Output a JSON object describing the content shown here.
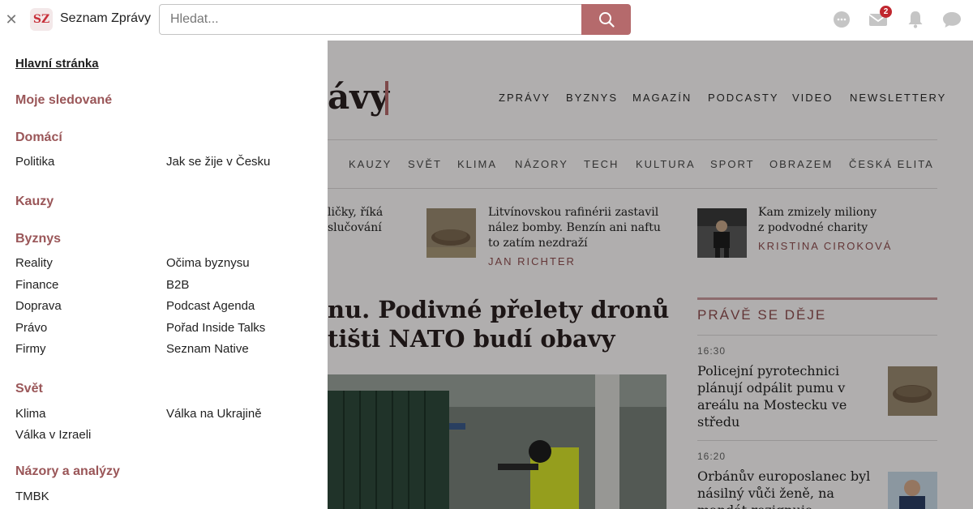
{
  "topbar": {
    "brand_logo": "SZ",
    "brand_name": "Seznam Zprávy",
    "search_placeholder": "Hledat...",
    "mail_badge": "2",
    "icons": [
      "close-icon",
      "search-icon",
      "chat-bubble-icon",
      "mail-icon",
      "bell-icon",
      "message-icon"
    ]
  },
  "drawer": {
    "home": "Hlavní stránka",
    "followed": "Moje sledované",
    "domestic": {
      "heading": "Domácí",
      "items": [
        "Politika",
        "Jak se žije v Česku"
      ]
    },
    "affairs": {
      "heading": "Kauzy"
    },
    "business": {
      "heading": "Byznys",
      "items": [
        "Reality",
        "Očima byznysu",
        "Finance",
        "B2B",
        "Doprava",
        "Podcast Agenda",
        "Právo",
        "Pořad Inside Talks",
        "Firmy",
        "Seznam Native"
      ]
    },
    "world": {
      "heading": "Svět",
      "items": [
        "Klima",
        "Válka na Ukrajině",
        "Válka v Izraeli"
      ]
    },
    "opinions": {
      "heading": "Názory a analýzy",
      "items": [
        "TMBK"
      ]
    }
  },
  "page": {
    "masthead": "ávy",
    "top_nav": [
      "ZPRÁVY",
      "BYZNYS",
      "MAGAZÍN",
      "PODCASTY",
      "VIDEO",
      "NEWSLETTERY"
    ],
    "sub_nav": [
      "KAUZY",
      "SVĚT",
      "KLIMA",
      "NÁZORY",
      "TECH",
      "KULTURA",
      "SPORT",
      "OBRAZEM",
      "ČESKÁ ELITA"
    ],
    "teaser_left": [
      "ličky, říká",
      "slučování"
    ],
    "teaser_mid": {
      "title": [
        "Litvínovskou rafinérii zastavil",
        "nález bomby. Benzín ani naftu",
        "to zatím nezdraží"
      ],
      "author": "JAN RICHTER"
    },
    "teaser_right": {
      "title": [
        "Kam zmizely miliony",
        "z podvodné charity"
      ],
      "author": "KRISTINA CIROKOVÁ"
    },
    "headline": "nu. Podivné přelety dronů\ntišti NATO budí obavy",
    "live": {
      "title": "PRÁVĚ SE DĚJE",
      "items": [
        {
          "time": "16:30",
          "text": "Policejní pyrotechnici plánují odpálit pumu v areálu na Mostecku ve středu"
        },
        {
          "time": "16:20",
          "text": "Orbánův europoslanec byl násilný vůči ženě, na mandát rezignuje"
        }
      ]
    }
  },
  "colors": {
    "accent": "#b56a6c",
    "heading": "#9a5658",
    "badge": "#c0262e"
  }
}
